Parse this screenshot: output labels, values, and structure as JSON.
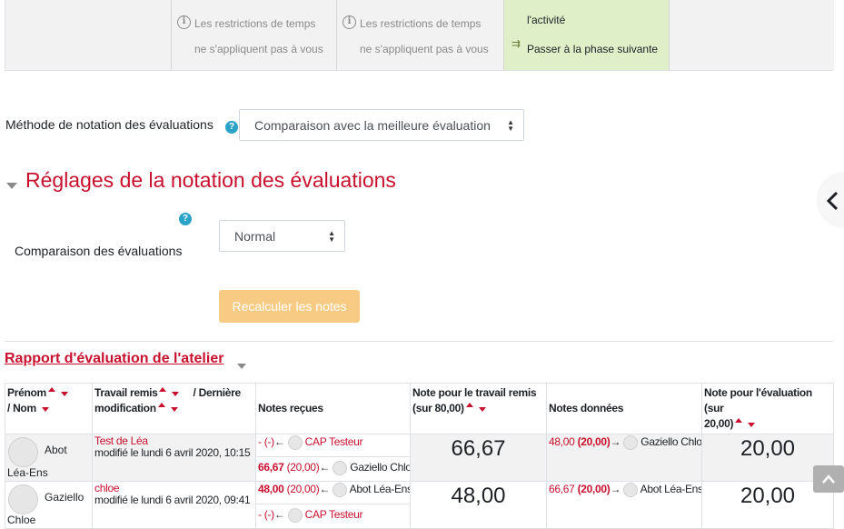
{
  "phases": {
    "col1_text": [
      "Les restrictions de temps",
      "ne s'appliquent pas à vous"
    ],
    "col2_text": [
      "Les restrictions de temps",
      "ne s'appliquent pas à vous"
    ],
    "col3_items": [
      "l'activité",
      "Passer à la phase suivante"
    ]
  },
  "scoring": {
    "method_label": "Méthode de notation des évaluations",
    "method_value": "Comparaison avec la meilleure évaluation"
  },
  "settings": {
    "section_title": "Réglages de la notation des évaluations",
    "comparison_label": "Comparaison des évaluations",
    "comparison_value": "Normal",
    "recalc_button": "Recalculer les notes"
  },
  "report": {
    "title": "Rapport d'évaluation de l'atelier",
    "headers": {
      "name_1": "Prénom",
      "name_2": "/ Nom",
      "submission_1": "Travail remis",
      "submission_2": "/ Dernière",
      "submission_3": "modification",
      "received": "Notes reçues",
      "sub_grade_1": "Note pour le travail remis",
      "sub_grade_2": "(sur 80,00)",
      "given": "Notes données",
      "assess_grade_1": "Note pour l'évaluation (sur",
      "assess_grade_2": "20,00)"
    },
    "rows": [
      {
        "first_name": "Abot",
        "last_name": "Léa-Ens",
        "submission_title": "Test de Léa",
        "submission_modified": "modifié le lundi 6 avril 2020, 10:15",
        "received": [
          {
            "prefix": "- (-)",
            "arrow": "←",
            "who": "CAP Testeur",
            "who_red": true
          },
          {
            "grade": "66,67",
            "paren": "(20,00)",
            "arrow": "←",
            "who": "Gaziello Chloe",
            "who_red": false
          }
        ],
        "submission_grade": "66,67",
        "given": {
          "grade": "48,00",
          "paren": "(20,00)",
          "arrow": "→",
          "who": "Gaziello Chloe"
        },
        "assessment_grade": "20,00"
      },
      {
        "first_name": "Gaziello",
        "last_name": "Chloe",
        "submission_title": "chloe",
        "submission_modified": "modifié le lundi 6 avril 2020, 09:41",
        "received": [
          {
            "grade": "48,00",
            "paren": "(20,00)",
            "arrow": "←",
            "who": "Abot Léa-Ens",
            "who_red": false
          },
          {
            "prefix": "- (-)",
            "arrow": "←",
            "who": "CAP Testeur",
            "who_red": true
          }
        ],
        "submission_grade": "48,00",
        "given": {
          "grade": "66,67",
          "paren": "(20,00)",
          "arrow": "→",
          "who": "Abot Léa-Ens"
        },
        "assessment_grade": "20,00"
      }
    ]
  },
  "icons": [
    "info-icon",
    "help-icon",
    "collapse-triangle-icon",
    "select-arrows-icon",
    "chevron-left-icon",
    "sort-up-icon",
    "sort-down-icon",
    "avatar-icon",
    "arrow-up-icon",
    "next-phase-icon"
  ],
  "colors": {
    "accent_red": "#c8102e",
    "active_phase": "#dff0c8",
    "help_blue": "#2aa3c7",
    "recalc_button": "#f8cb85"
  }
}
